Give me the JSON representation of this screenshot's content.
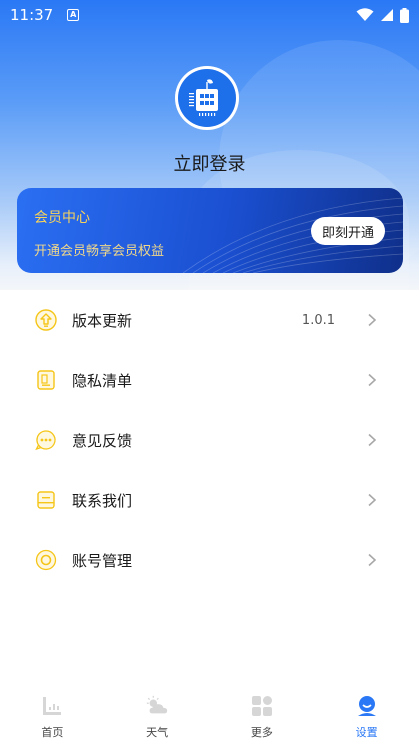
{
  "status_bar": {
    "time": "11:37",
    "notif_glyph": "A"
  },
  "profile": {
    "login_label": "立即登录"
  },
  "member_card": {
    "title": "会员中心",
    "subtitle": "开通会员畅享会员权益",
    "button_label": "即刻开通"
  },
  "menu": {
    "items": [
      {
        "label": "版本更新",
        "value": "1.0.1",
        "icon": "upgrade-icon"
      },
      {
        "label": "隐私清单",
        "value": "",
        "icon": "document-icon"
      },
      {
        "label": "意见反馈",
        "value": "",
        "icon": "chat-bubble-icon"
      },
      {
        "label": "联系我们",
        "value": "",
        "icon": "contact-card-icon"
      },
      {
        "label": "账号管理",
        "value": "",
        "icon": "account-ring-icon"
      }
    ]
  },
  "tab_bar": {
    "tabs": [
      {
        "label": "首页",
        "icon": "home-icon",
        "active": false
      },
      {
        "label": "天气",
        "icon": "weather-icon",
        "active": false
      },
      {
        "label": "更多",
        "icon": "grid-icon",
        "active": false
      },
      {
        "label": "设置",
        "icon": "user-icon",
        "active": true
      }
    ]
  },
  "colors": {
    "accent": "#2a78f5",
    "member_gold": "#f7d35a",
    "icon_yellow": "#f5c518"
  }
}
